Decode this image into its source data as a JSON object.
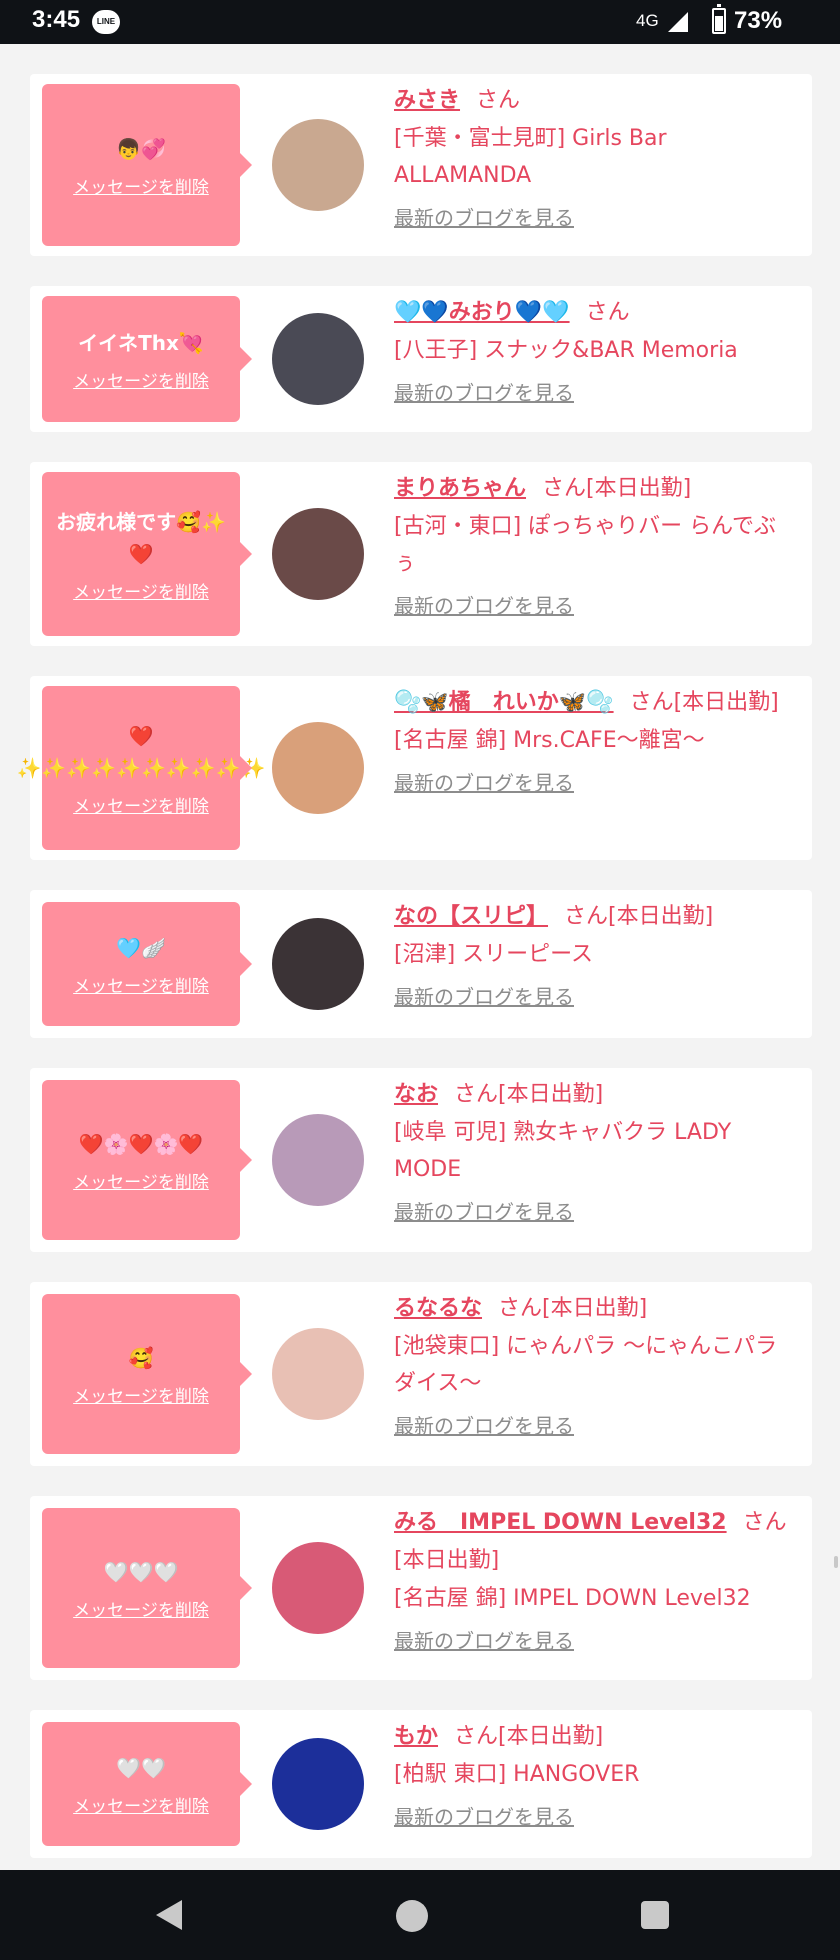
{
  "status_bar": {
    "time": "3:45",
    "app_badge": "LINE",
    "network": "4G",
    "battery": "73%"
  },
  "common": {
    "delete_label": "メッセージを削除",
    "blog_label": "最新のブログを見る"
  },
  "messages": [
    {
      "text": "👦💞",
      "name": "みさき",
      "suffix": "さん",
      "shop": "[千葉・富士見町] Girls Bar ALLAMANDA",
      "avatar_color": "#c9a890"
    },
    {
      "text": "イイネThx💘",
      "name": "🩵💙みおり💙🩵",
      "suffix": "さん",
      "shop": "[八王子] スナック&BAR Memoria",
      "avatar_color": "#4a4a55"
    },
    {
      "text": "お疲れ様です🥰✨❤️",
      "name": "まりあちゃん",
      "suffix": "さん[本日出勤]",
      "shop": "[古河・東口] ぽっちゃりバー らんでぶぅ",
      "avatar_color": "#6a4a48"
    },
    {
      "text": "❤️✨✨✨✨✨✨✨✨✨✨",
      "name": "🫧🦋橘　れいか🦋🫧",
      "suffix": "さん[本日出勤]",
      "shop": "[名古屋 錦] Mrs.CAFE〜離宮〜",
      "avatar_color": "#d9a07a"
    },
    {
      "text": "🩵🪽",
      "name": "なの【スリピ】",
      "suffix": "さん[本日出勤]",
      "shop": "[沼津] スリーピース",
      "avatar_color": "#3b3336"
    },
    {
      "text": "❤️🌸❤️🌸❤️",
      "name": "なお",
      "suffix": "さん[本日出勤]",
      "shop": "[岐阜 可児] 熟女キャバクラ LADY MODE",
      "avatar_color": "#b89ab8"
    },
    {
      "text": "🥰",
      "name": "るなるな",
      "suffix": "さん[本日出勤]",
      "shop": "[池袋東口] にゃんパラ 〜にゃんこパラダイス〜",
      "avatar_color": "#e8c0b4"
    },
    {
      "text": "🤍🤍🤍",
      "name": "みる　IMPEL DOWN Level32",
      "suffix": "さん[本日出勤]",
      "shop": "[名古屋 錦] IMPEL DOWN Level32",
      "avatar_color": "#d85a76"
    },
    {
      "text": "🤍🤍",
      "name": "もか",
      "suffix": "さん[本日出勤]",
      "shop": "[柏駅 東口] HANGOVER",
      "avatar_color": "#1c2f9a"
    }
  ]
}
